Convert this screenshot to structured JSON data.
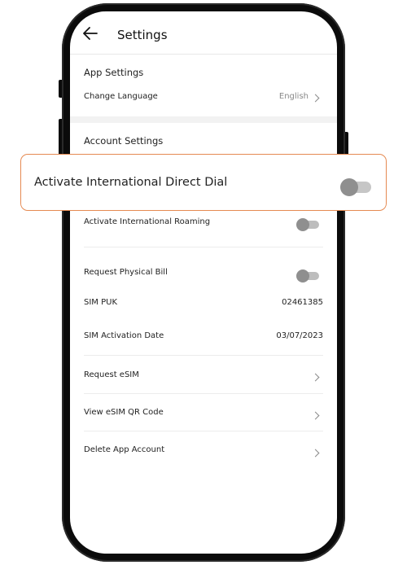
{
  "header": {
    "title": "Settings",
    "back_icon": "back-arrow-icon"
  },
  "app_settings": {
    "section_title": "App Settings",
    "language_label": "Change Language",
    "language_value": "English"
  },
  "account_settings": {
    "section_title": "Account Settings",
    "roaming_label": "Activate International Roaming",
    "roaming_on": false,
    "physical_bill_label": "Request Physical Bill",
    "physical_bill_on": false,
    "sim_puk_label": "SIM PUK",
    "sim_puk_value": "02461385",
    "activation_date_label": "SIM Activation Date",
    "activation_date_value": "03/07/2023",
    "request_esim_label": "Request eSIM",
    "view_qr_label": "View eSIM QR Code",
    "delete_account_label": "Delete App Account"
  },
  "highlight": {
    "label": "Activate International Direct Dial",
    "toggle_on": false,
    "border_color": "#e58a52"
  }
}
